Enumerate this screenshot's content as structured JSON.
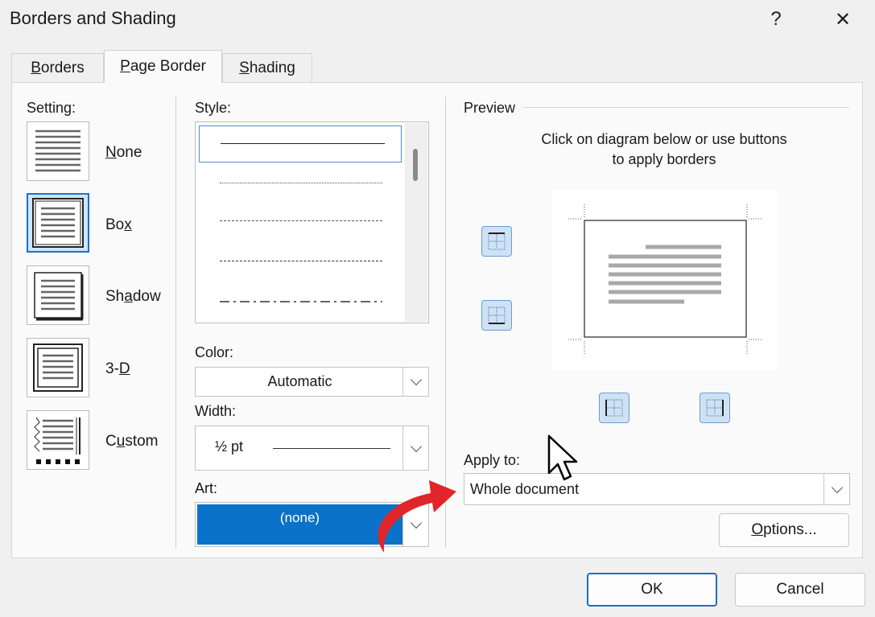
{
  "window": {
    "title": "Borders and Shading",
    "help_glyph": "?",
    "close_glyph": "✕"
  },
  "tabs": [
    {
      "label": "Borders",
      "mnemonic": "B",
      "rest": "orders"
    },
    {
      "label": "Page Border",
      "mnemonic": "P",
      "rest": "age Border"
    },
    {
      "label": "Shading",
      "mnemonic": "S",
      "rest": "hading"
    }
  ],
  "setting": {
    "label": "Setting:",
    "options": [
      {
        "label": "None",
        "pre": "",
        "mn": "N",
        "post": "one",
        "selected": false
      },
      {
        "label": "Box",
        "pre": "Bo",
        "mn": "x",
        "post": "",
        "selected": true
      },
      {
        "label": "Shadow",
        "pre": "Sh",
        "mn": "a",
        "post": "dow",
        "selected": false
      },
      {
        "label": "3-D",
        "pre": "3-",
        "mn": "D",
        "post": "",
        "selected": false
      },
      {
        "label": "Custom",
        "pre": "C",
        "mn": "u",
        "post": "stom",
        "selected": false
      }
    ]
  },
  "style": {
    "label": "Style:",
    "lines": [
      "solid",
      "dotted",
      "dashed-small",
      "dashed",
      "dash-dot"
    ]
  },
  "color": {
    "label": "Color:",
    "value": "Automatic"
  },
  "width": {
    "label": "Width:",
    "value": "½ pt"
  },
  "art": {
    "label": "Art:",
    "value": "(none)"
  },
  "preview": {
    "label": "Preview",
    "instructions_line1": "Click on diagram below or use buttons",
    "instructions_line2": "to apply borders"
  },
  "apply_to": {
    "label": "Apply to:",
    "value": "Whole document"
  },
  "buttons": {
    "options": "Options...",
    "ok": "OK",
    "cancel": "Cancel"
  },
  "colors": {
    "accent": "#1a73c8",
    "art_selected": "#0a72c8",
    "arrow": "#e0262a"
  }
}
